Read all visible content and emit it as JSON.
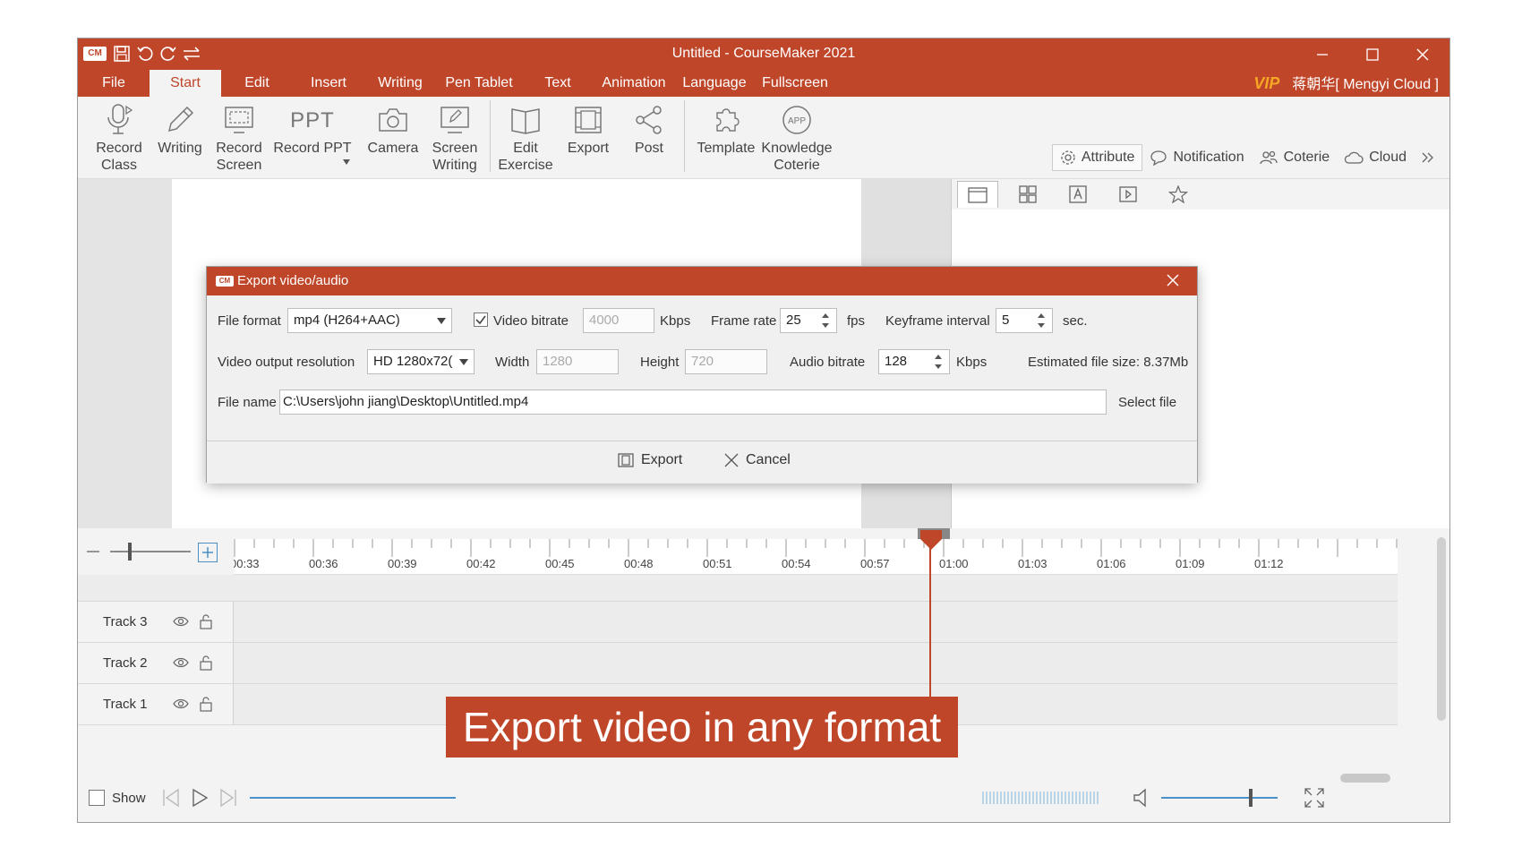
{
  "app": {
    "title": "Untitled - CourseMaker 2021",
    "logo": "CM",
    "accent_color": "#c0462a"
  },
  "menubar": {
    "items": [
      "File",
      "Start",
      "Edit",
      "Insert",
      "Writing",
      "Pen Tablet",
      "Text",
      "Animation",
      "Language",
      "Fullscreen"
    ],
    "active": "Start",
    "vip_badge": "VIP",
    "user": "蒋朝华[ Mengyi Cloud ]"
  },
  "ribbon": {
    "buttons": [
      {
        "line1": "Record",
        "line2": "Class",
        "icon": "microphone-icon"
      },
      {
        "line1": "Writing",
        "line2": "",
        "icon": "pen-icon"
      },
      {
        "line1": "Record",
        "line2": "Screen",
        "icon": "screen-capture-icon"
      },
      {
        "line1": "Record PPT",
        "line2": "",
        "icon": "ppt-icon"
      },
      {
        "line1": "Camera",
        "line2": "",
        "icon": "camera-icon"
      },
      {
        "line1": "Screen",
        "line2": "Writing",
        "icon": "screen-writing-icon"
      },
      {
        "line1": "Edit",
        "line2": "Exercise",
        "icon": "book-icon"
      },
      {
        "line1": "Export",
        "line2": "",
        "icon": "export-icon"
      },
      {
        "line1": "Post",
        "line2": "",
        "icon": "share-icon"
      },
      {
        "line1": "Template",
        "line2": "",
        "icon": "puzzle-icon"
      },
      {
        "line1": "Knowledge",
        "line2": "Coterie",
        "icon": "app-icon"
      }
    ],
    "panel_tabs": [
      "Attribute",
      "Notification",
      "Coterie",
      "Cloud"
    ]
  },
  "timeline": {
    "ruler_labels": [
      "00:33",
      "00:36",
      "00:39",
      "00:42",
      "00:45",
      "00:48",
      "00:51",
      "00:54",
      "00:57",
      "01:00",
      "01:03",
      "01:06",
      "01:09",
      "01:12"
    ],
    "tracks": [
      "Track 3",
      "Track 2",
      "Track 1"
    ],
    "show_label": "Show"
  },
  "dialog": {
    "title": "Export video/audio",
    "file_format_label": "File format",
    "file_format_value": "mp4 (H264+AAC)",
    "video_bitrate_label": "Video bitrate",
    "video_bitrate_value": "4000",
    "video_bitrate_checked": true,
    "kbps": "Kbps",
    "frame_rate_label": "Frame rate",
    "frame_rate_value": "25",
    "fps": "fps",
    "keyframe_label": "Keyframe interval",
    "keyframe_value": "5",
    "sec": "sec.",
    "resolution_label": "Video output resolution",
    "resolution_value": "HD 1280x72(",
    "width_label": "Width",
    "width_value": "1280",
    "height_label": "Height",
    "height_value": "720",
    "audio_bitrate_label": "Audio bitrate",
    "audio_bitrate_value": "128",
    "estimated_size": "Estimated file size: 8.37Mb",
    "file_name_label": "File name",
    "file_name_value": "C:\\Users\\john jiang\\Desktop\\Untitled.mp4",
    "select_file": "Select file",
    "export_button": "Export",
    "cancel_button": "Cancel"
  },
  "banner": {
    "text": "Export video in any format"
  }
}
